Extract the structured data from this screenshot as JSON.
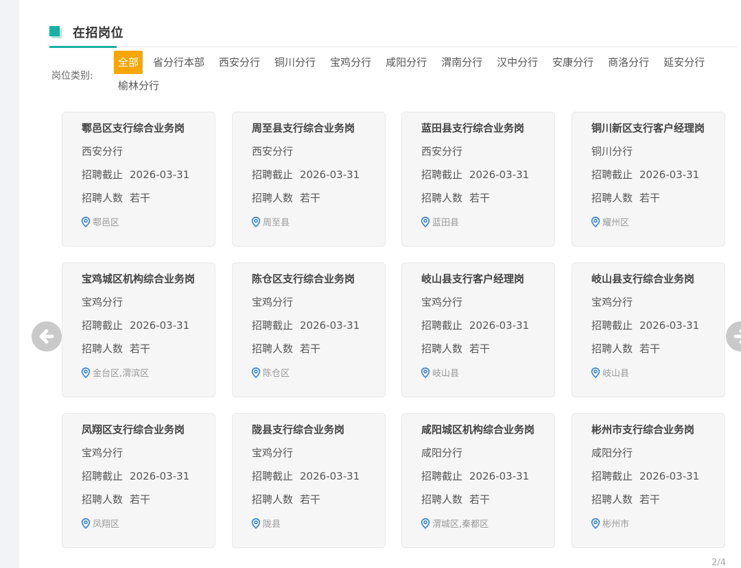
{
  "section": {
    "title": "在招岗位"
  },
  "filter": {
    "label": "岗位类别:",
    "items": [
      "全部",
      "省分行本部",
      "西安分行",
      "铜川分行",
      "宝鸡分行",
      "咸阳分行",
      "渭南分行",
      "汉中分行",
      "安康分行",
      "商洛分行",
      "延安分行",
      "榆林分行"
    ],
    "active_index": 0
  },
  "cards": [
    {
      "title": "鄠邑区支行综合业务岗",
      "branch": "西安分行",
      "deadline_label": "招聘截止",
      "deadline": "2026-03-31",
      "count_label": "招聘人数",
      "count": "若干",
      "location": "鄠邑区"
    },
    {
      "title": "周至县支行综合业务岗",
      "branch": "西安分行",
      "deadline_label": "招聘截止",
      "deadline": "2026-03-31",
      "count_label": "招聘人数",
      "count": "若干",
      "location": "周至县"
    },
    {
      "title": "蓝田县支行综合业务岗",
      "branch": "西安分行",
      "deadline_label": "招聘截止",
      "deadline": "2026-03-31",
      "count_label": "招聘人数",
      "count": "若干",
      "location": "蓝田县"
    },
    {
      "title": "铜川新区支行客户经理岗",
      "branch": "铜川分行",
      "deadline_label": "招聘截止",
      "deadline": "2026-03-31",
      "count_label": "招聘人数",
      "count": "若干",
      "location": "耀州区"
    },
    {
      "title": "宝鸡城区机构综合业务岗",
      "branch": "宝鸡分行",
      "deadline_label": "招聘截止",
      "deadline": "2026-03-31",
      "count_label": "招聘人数",
      "count": "若干",
      "location": "金台区,渭滨区"
    },
    {
      "title": "陈仓区支行综合业务岗",
      "branch": "宝鸡分行",
      "deadline_label": "招聘截止",
      "deadline": "2026-03-31",
      "count_label": "招聘人数",
      "count": "若干",
      "location": "陈仓区"
    },
    {
      "title": "岐山县支行客户经理岗",
      "branch": "宝鸡分行",
      "deadline_label": "招聘截止",
      "deadline": "2026-03-31",
      "count_label": "招聘人数",
      "count": "若干",
      "location": "岐山县"
    },
    {
      "title": "岐山县支行综合业务岗",
      "branch": "宝鸡分行",
      "deadline_label": "招聘截止",
      "deadline": "2026-03-31",
      "count_label": "招聘人数",
      "count": "若干",
      "location": "岐山县"
    },
    {
      "title": "凤翔区支行综合业务岗",
      "branch": "宝鸡分行",
      "deadline_label": "招聘截止",
      "deadline": "2026-03-31",
      "count_label": "招聘人数",
      "count": "若干",
      "location": "凤翔区"
    },
    {
      "title": "陇县支行综合业务岗",
      "branch": "宝鸡分行",
      "deadline_label": "招聘截止",
      "deadline": "2026-03-31",
      "count_label": "招聘人数",
      "count": "若干",
      "location": "陇县"
    },
    {
      "title": "咸阳城区机构综合业务岗",
      "branch": "咸阳分行",
      "deadline_label": "招聘截止",
      "deadline": "2026-03-31",
      "count_label": "招聘人数",
      "count": "若干",
      "location": "渭城区,秦都区"
    },
    {
      "title": "彬州市支行综合业务岗",
      "branch": "咸阳分行",
      "deadline_label": "招聘截止",
      "deadline": "2026-03-31",
      "count_label": "招聘人数",
      "count": "若干",
      "location": "彬州市"
    }
  ],
  "pager": {
    "text": "2/4"
  },
  "colors": {
    "accent": "#17b0a4",
    "active_filter": "#f7a600",
    "pin": "#2f7fd6"
  },
  "icons": {
    "location": "location-pin-icon",
    "prev": "arrow-left-icon",
    "next": "arrow-right-icon"
  }
}
